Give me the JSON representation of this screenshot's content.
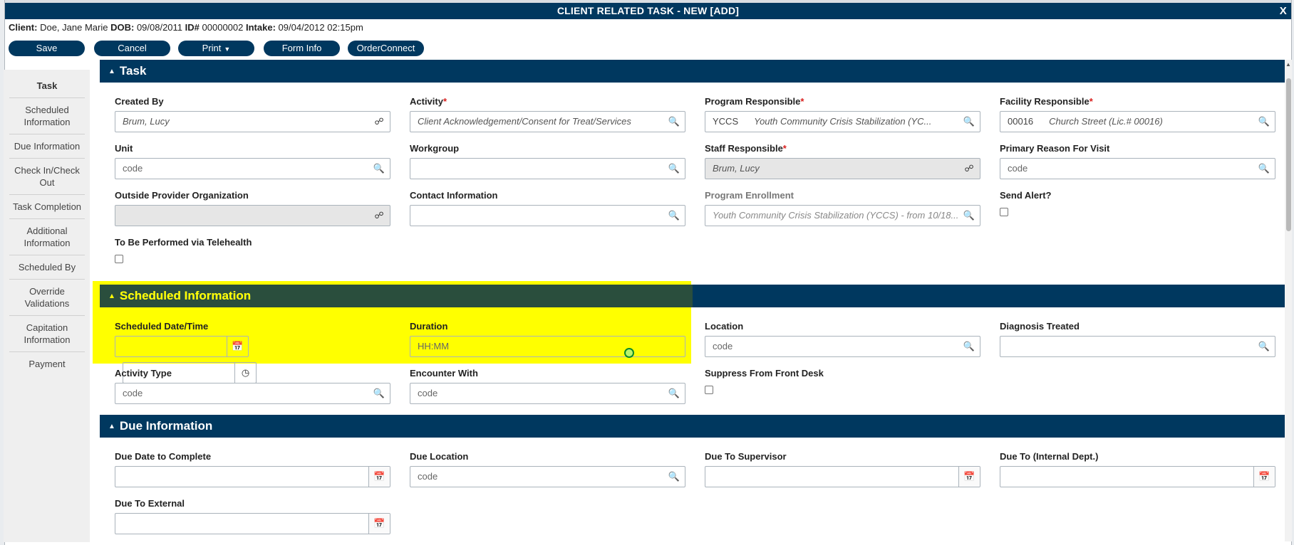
{
  "dialog": {
    "title": "CLIENT RELATED TASK - NEW [ADD]",
    "close_label": "X"
  },
  "client": {
    "client_label": "Client:",
    "client_name": "Doe, Jane Marie",
    "dob_label": "DOB:",
    "dob": "09/08/2011",
    "id_label": "ID#",
    "id": "00000002",
    "intake_label": "Intake:",
    "intake": "09/04/2012 02:15pm"
  },
  "toolbar": {
    "save": "Save",
    "cancel": "Cancel",
    "print": "Print",
    "form_info": "Form Info",
    "order_connect": "OrderConnect"
  },
  "sidenav": {
    "items": [
      "Task",
      "Scheduled Information",
      "Due Information",
      "Check In/Check Out",
      "Task Completion",
      "Additional Information",
      "Scheduled By",
      "Override Validations",
      "Capitation Information",
      "Payment"
    ]
  },
  "sections": {
    "task": "Task",
    "scheduled": "Scheduled Information",
    "due": "Due Information"
  },
  "task": {
    "created_by": {
      "label": "Created By",
      "value": "Brum, Lucy"
    },
    "activity": {
      "label": "Activity",
      "value": "Client Acknowledgement/Consent for Treat/Services"
    },
    "program_responsible": {
      "label": "Program Responsible",
      "code": "YCCS",
      "value": "Youth Community Crisis Stabilization (YC..."
    },
    "facility_responsible": {
      "label": "Facility Responsible",
      "code": "00016",
      "value": "Church Street (Lic.# 00016)"
    },
    "unit": {
      "label": "Unit",
      "placeholder": "code"
    },
    "workgroup": {
      "label": "Workgroup",
      "value": ""
    },
    "staff_responsible": {
      "label": "Staff Responsible",
      "value": "Brum, Lucy"
    },
    "primary_reason": {
      "label": "Primary Reason For Visit",
      "placeholder": "code"
    },
    "outside_provider": {
      "label": "Outside Provider Organization",
      "value": ""
    },
    "contact_information": {
      "label": "Contact Information",
      "value": ""
    },
    "program_enrollment": {
      "label": "Program Enrollment",
      "value": "Youth Community Crisis Stabilization (YCCS) - from 10/18..."
    },
    "send_alert": {
      "label": "Send Alert?"
    },
    "telehealth": {
      "label": "To Be Performed via Telehealth"
    },
    "required_mark": "*"
  },
  "scheduled": {
    "date_time": {
      "label": "Scheduled Date/Time"
    },
    "duration": {
      "label": "Duration",
      "placeholder": "HH:MM"
    },
    "location": {
      "label": "Location",
      "placeholder": "code"
    },
    "diagnosis": {
      "label": "Diagnosis Treated"
    },
    "activity_type": {
      "label": "Activity Type",
      "placeholder": "code"
    },
    "encounter_with": {
      "label": "Encounter With",
      "placeholder": "code"
    },
    "suppress": {
      "label": "Suppress From Front Desk"
    }
  },
  "due": {
    "date_to_complete": {
      "label": "Due Date to Complete"
    },
    "location": {
      "label": "Due Location",
      "placeholder": "code"
    },
    "to_supervisor": {
      "label": "Due To Supervisor"
    },
    "to_internal": {
      "label": "Due To (Internal Dept.)"
    },
    "to_external": {
      "label": "Due To External"
    }
  },
  "icons": {
    "search": "magnifier",
    "lookup": "binoculars",
    "calendar": "calendar",
    "clock": "clock",
    "collapse": "triangle-up"
  },
  "colors": {
    "primary": "#00385f",
    "highlight": "#ffff00",
    "required": "#d9201e",
    "nav_bg": "#efefef"
  }
}
